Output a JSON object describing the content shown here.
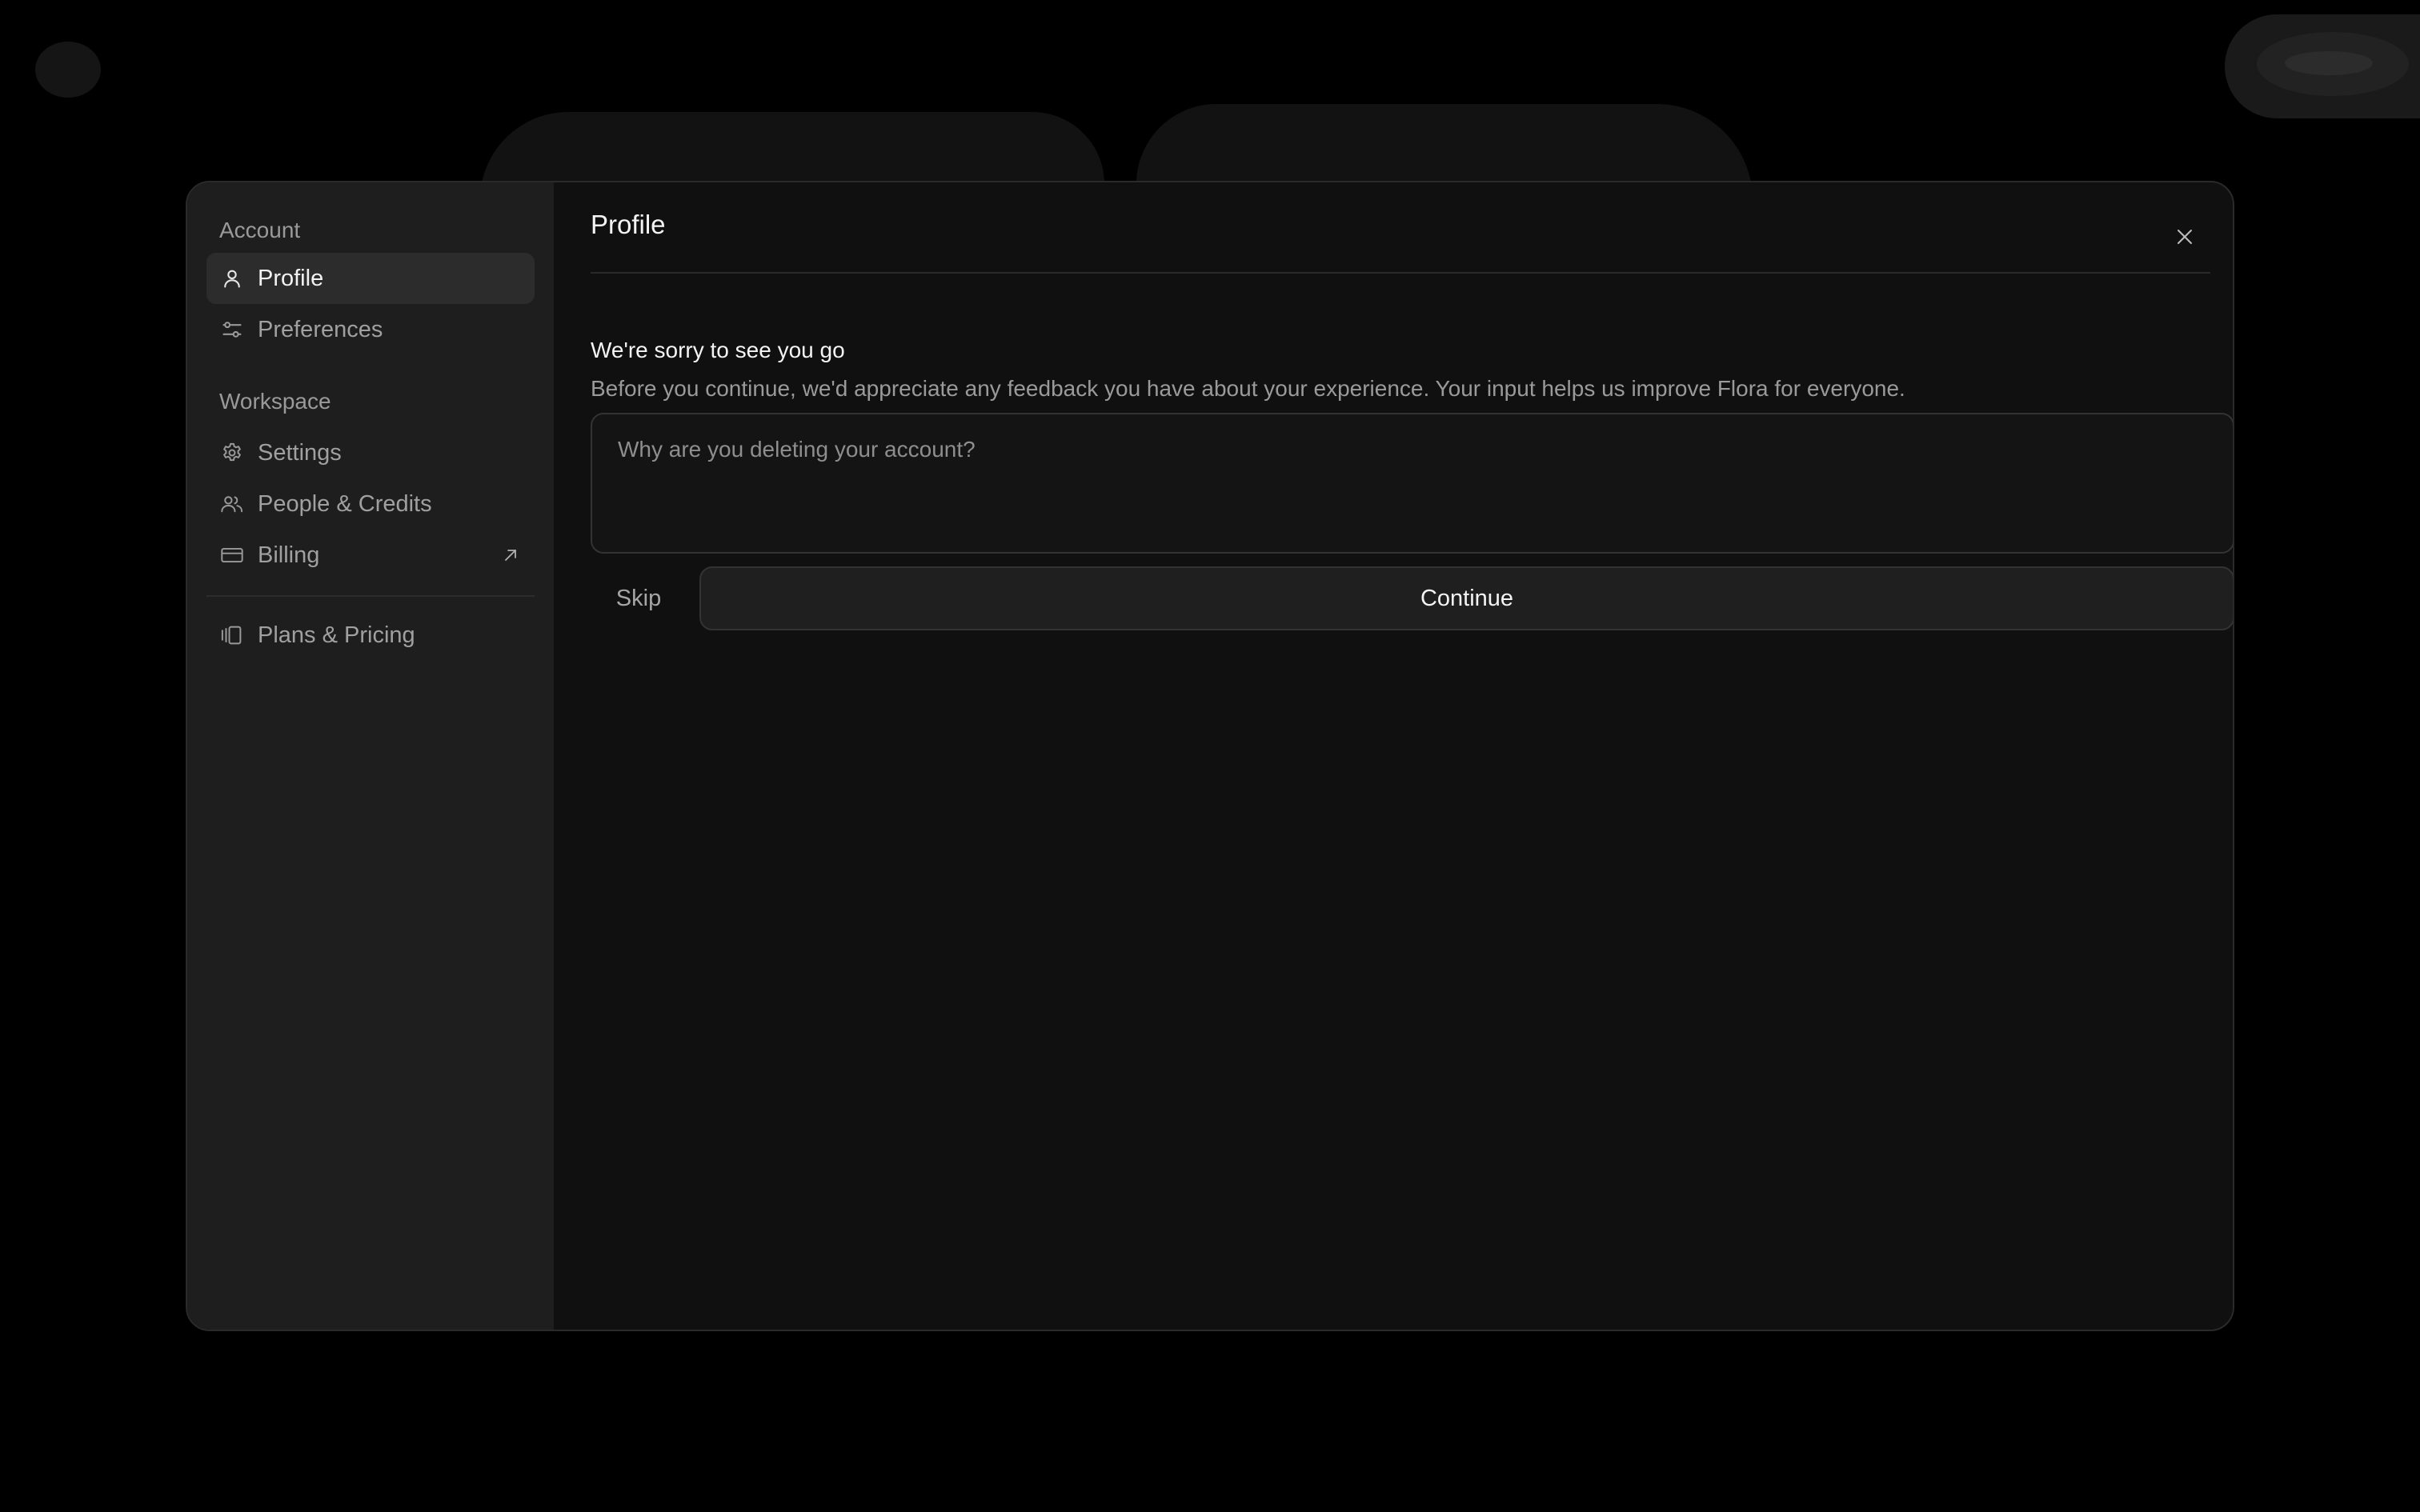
{
  "sidebar": {
    "account_heading": "Account",
    "account_items": [
      {
        "label": "Profile",
        "icon": "user-icon",
        "active": true
      },
      {
        "label": "Preferences",
        "icon": "sliders-icon",
        "active": false
      }
    ],
    "workspace_heading": "Workspace",
    "workspace_items": [
      {
        "label": "Settings",
        "icon": "gear-icon"
      },
      {
        "label": "People & Credits",
        "icon": "people-icon"
      },
      {
        "label": "Billing",
        "icon": "credit-card-icon",
        "external": true,
        "external_icon": "arrow-up-right-icon"
      }
    ],
    "plans_item": {
      "label": "Plans & Pricing",
      "icon": "plans-icon"
    }
  },
  "main": {
    "title": "Profile",
    "close_icon": "close-icon",
    "feedback": {
      "heading": "We're sorry to see you go",
      "description": "Before you continue, we'd appreciate any feedback you have about your experience. Your input helps us improve Flora for everyone.",
      "placeholder": "Why are you deleting your account?",
      "value": ""
    },
    "actions": {
      "skip_label": "Skip",
      "continue_label": "Continue"
    }
  },
  "colors": {
    "background": "#000000",
    "modal": "#111111",
    "sidebar": "#1e1e1e",
    "active_item": "#2c2c2c",
    "text_primary": "#f4f4f4",
    "text_secondary": "#9a9a9a"
  }
}
